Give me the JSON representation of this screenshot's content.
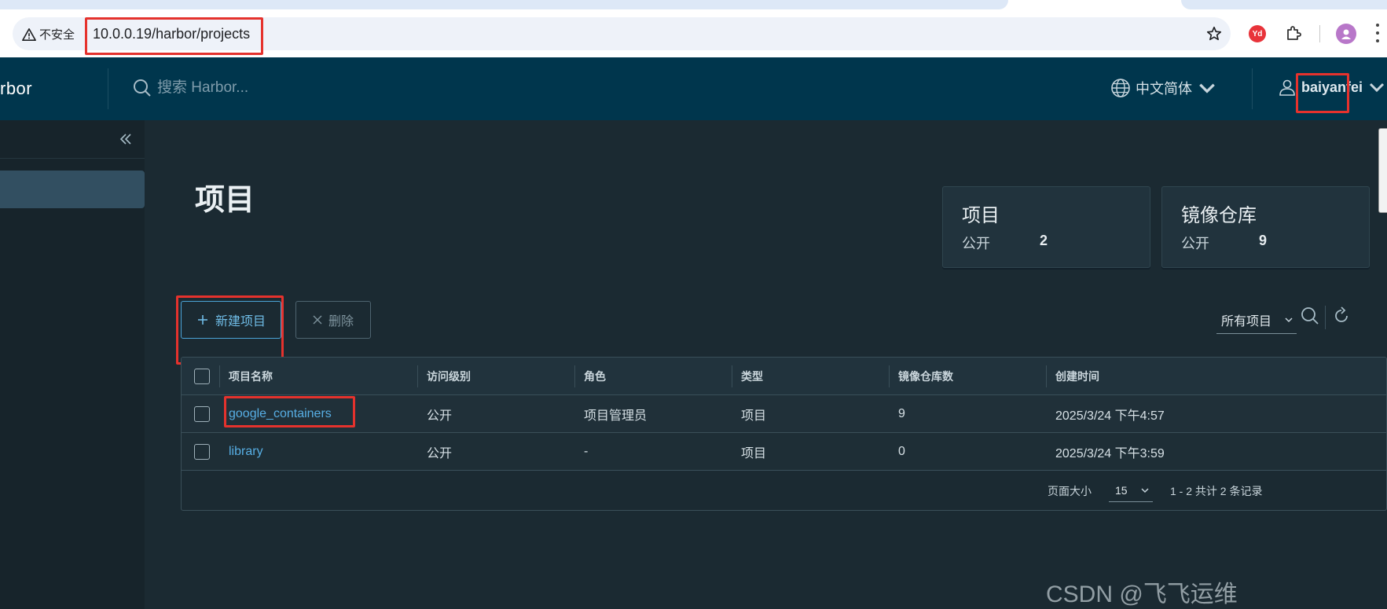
{
  "browser": {
    "security_label": "不安全",
    "url": "10.0.0.19/harbor/projects",
    "extension_label": "Yd"
  },
  "header": {
    "brand": "rbor",
    "search_placeholder": "搜索 Harbor...",
    "language": "中文简体",
    "username": "baiyanfei"
  },
  "page": {
    "title": "项目"
  },
  "stats": [
    {
      "title": "项目",
      "label": "公开",
      "value": "2"
    },
    {
      "title": "镜像仓库",
      "label": "公开",
      "value": "9"
    }
  ],
  "toolbar": {
    "new_label": "新建项目",
    "delete_label": "删除",
    "filter_label": "所有项目"
  },
  "table": {
    "columns": [
      "项目名称",
      "访问级别",
      "角色",
      "类型",
      "镜像仓库数",
      "创建时间"
    ],
    "rows": [
      {
        "name": "google_containers",
        "access": "公开",
        "role": "项目管理员",
        "type": "项目",
        "repo_count": "9",
        "created": "2025/3/24 下午4:57"
      },
      {
        "name": "library",
        "access": "公开",
        "role": "-",
        "type": "项目",
        "repo_count": "0",
        "created": "2025/3/24 下午3:59"
      }
    ]
  },
  "pagination": {
    "page_size_label": "页面大小",
    "page_size": "15",
    "summary": "1 - 2 共计 2 条记录"
  },
  "watermark": "CSDN @飞飞运维",
  "colors": {
    "header_bg": "#00364d",
    "main_bg": "#1b2a32",
    "accent": "#57aee4",
    "highlight": "#e5322d"
  }
}
